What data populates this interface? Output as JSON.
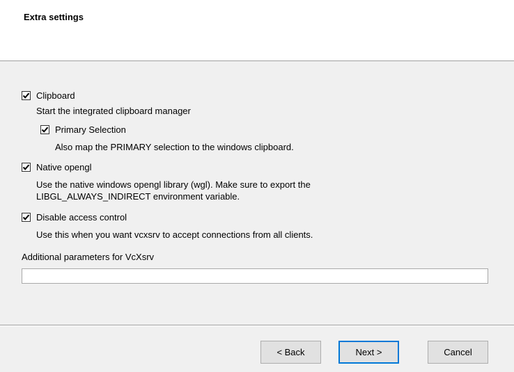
{
  "header": {
    "title": "Extra settings"
  },
  "options": {
    "clipboard": {
      "label": "Clipboard",
      "checked": true,
      "description": "Start the integrated clipboard manager"
    },
    "primary_selection": {
      "label": "Primary Selection",
      "checked": true,
      "description": "Also map the PRIMARY selection to the windows clipboard."
    },
    "native_opengl": {
      "label": "Native opengl",
      "checked": true,
      "description_line1": "Use the native windows opengl library (wgl). Make sure to export the",
      "description_line2": "LIBGL_ALWAYS_INDIRECT environment variable."
    },
    "disable_access_control": {
      "label": "Disable access control",
      "checked": true,
      "description": "Use this when you want vcxsrv to accept connections from all clients."
    }
  },
  "additional_params": {
    "label": "Additional parameters for VcXsrv",
    "value": ""
  },
  "buttons": {
    "back": "< Back",
    "next": "Next >",
    "cancel": "Cancel"
  }
}
